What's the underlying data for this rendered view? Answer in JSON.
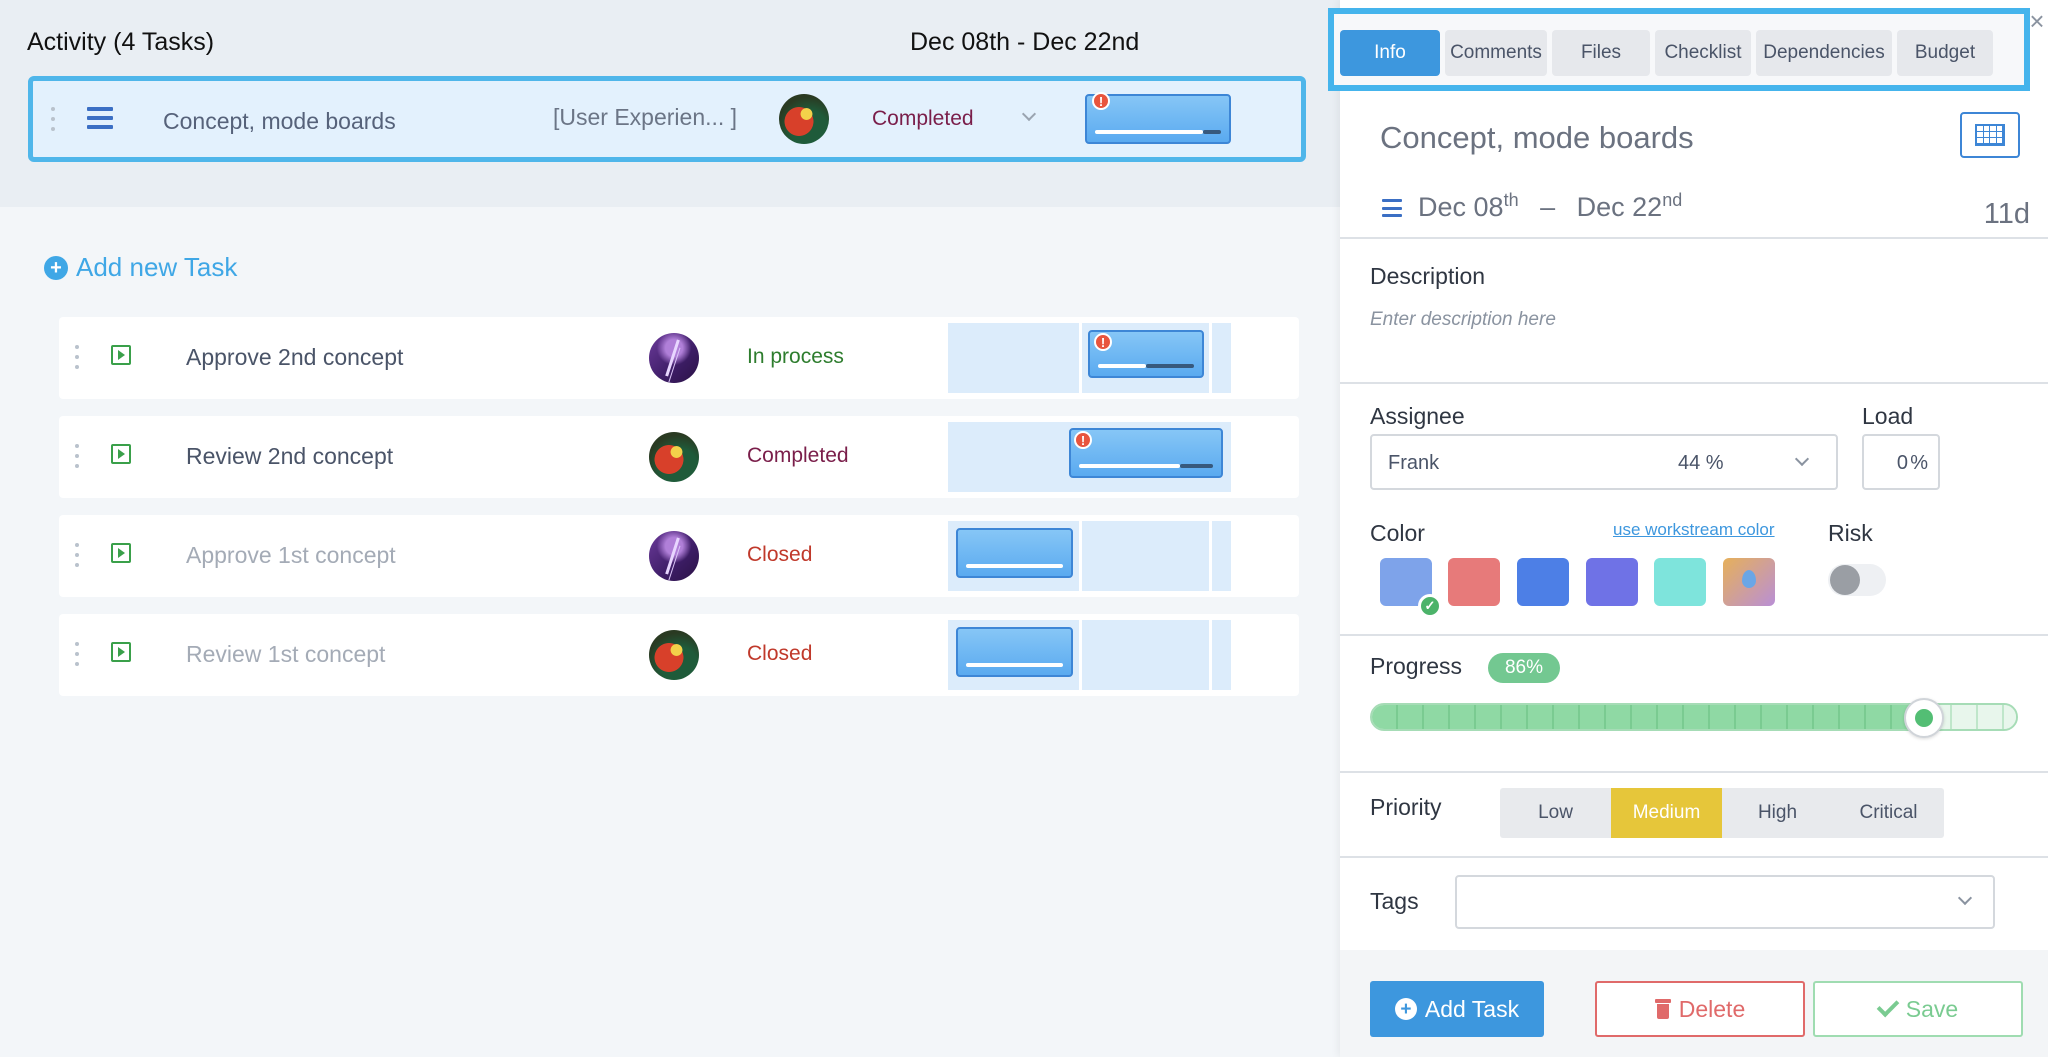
{
  "activity": {
    "title": "Activity (4 Tasks)",
    "date_range": "Dec 08th -  Dec 22nd"
  },
  "parent_task": {
    "name": "Concept, mode boards",
    "workstream": "[User Experien... ]",
    "status": "Completed",
    "progress_fraction": 0.86
  },
  "add_task_link": "Add new Task",
  "tasks": [
    {
      "name": "Approve 2nd concept",
      "status": "In process",
      "avatar": "storm-avatar",
      "progress_fraction": 0.5
    },
    {
      "name": "Review 2nd concept",
      "status": "Completed",
      "avatar": "parrot-avatar",
      "progress_fraction": 0.75
    },
    {
      "name": "Approve 1st concept",
      "status": "Closed",
      "avatar": "storm-avatar",
      "progress_fraction": 1.0
    },
    {
      "name": "Review 1st concept",
      "status": "Closed",
      "avatar": "parrot-avatar",
      "progress_fraction": 1.0
    }
  ],
  "panel": {
    "tabs": [
      "Info",
      "Comments",
      "Files",
      "Checklist",
      "Dependencies",
      "Budget"
    ],
    "active_tab": "Info",
    "close_icon": "×",
    "title": "Concept, mode boards",
    "start_date": "Dec 08",
    "start_suffix": "th",
    "dash": "–",
    "end_date": "Dec 22",
    "end_suffix": "nd",
    "duration": "11d",
    "description_label": "Description",
    "description_placeholder": "Enter description here",
    "assignee_label": "Assignee",
    "assignee_name": "Frank",
    "assignee_load": "44 %",
    "load_label": "Load",
    "load_value": "0",
    "load_unit": "%",
    "color_label": "Color",
    "workstream_color_link": "use workstream color",
    "risk_label": "Risk",
    "risk_enabled": false,
    "colors": [
      "#7ea3ea",
      "#e77a7a",
      "#4d7fe6",
      "#6f72e6",
      "#7ee4dc",
      "gradient-drop"
    ],
    "selected_color_index": 0,
    "progress_label": "Progress",
    "progress_value": "86%",
    "progress_fraction": 0.86,
    "priority_label": "Priority",
    "priorities": [
      "Low",
      "Medium",
      "High",
      "Critical"
    ],
    "active_priority": "Medium",
    "tags_label": "Tags",
    "buttons": {
      "add": "Add Task",
      "delete": "Delete",
      "save": "Save"
    }
  }
}
